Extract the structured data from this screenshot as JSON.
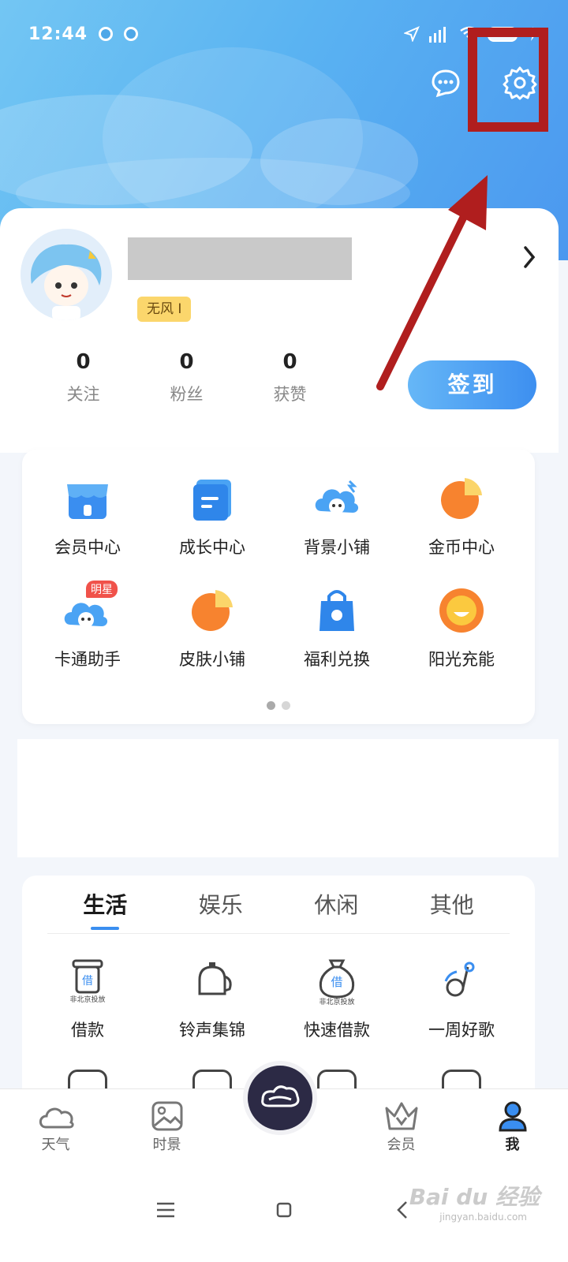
{
  "status_bar": {
    "time": "12:44",
    "battery": "40"
  },
  "profile": {
    "badge": "无风 I",
    "stats": [
      {
        "value": "0",
        "label": "关注"
      },
      {
        "value": "0",
        "label": "粉丝"
      },
      {
        "value": "0",
        "label": "获赞"
      }
    ],
    "signin_label": "签到"
  },
  "feature_grid": {
    "items": [
      {
        "label": "会员中心",
        "icon": "store-icon"
      },
      {
        "label": "成长中心",
        "icon": "document-icon"
      },
      {
        "label": "背景小铺",
        "icon": "cloud-character-icon"
      },
      {
        "label": "金币中心",
        "icon": "coin-pie-icon"
      },
      {
        "label": "卡通助手",
        "icon": "cartoon-helper-icon",
        "tag": "明星"
      },
      {
        "label": "皮肤小铺",
        "icon": "skin-pie-icon"
      },
      {
        "label": "福利兑换",
        "icon": "gift-bag-icon"
      },
      {
        "label": "阳光充能",
        "icon": "sun-icon"
      }
    ],
    "page_count": 2,
    "current_page": 1
  },
  "categories": {
    "tabs": [
      "生活",
      "娱乐",
      "休闲",
      "其他"
    ],
    "active_tab": "生活",
    "items": [
      {
        "label": "借款",
        "icon": "loan-icon",
        "icon_text": "借",
        "sub": "非北京投放"
      },
      {
        "label": "铃声集锦",
        "icon": "bell-icon"
      },
      {
        "label": "快速借款",
        "icon": "money-bag-icon",
        "icon_text": "借",
        "sub": "非北京投放"
      },
      {
        "label": "一周好歌",
        "icon": "music-note-icon"
      }
    ]
  },
  "bottom_nav": {
    "items": [
      {
        "label": "天气",
        "icon": "cloud-icon"
      },
      {
        "label": "时景",
        "icon": "picture-icon"
      },
      {
        "label": "",
        "icon": "center-logo-icon"
      },
      {
        "label": "会员",
        "icon": "crown-icon"
      },
      {
        "label": "我",
        "icon": "person-icon"
      }
    ],
    "active": "我"
  },
  "watermark": {
    "text": "Bai du 经验",
    "sub": "jingyan.baidu.com"
  },
  "colors": {
    "accent": "#3d8ff0",
    "highlight": "#b01e1e",
    "badge": "#fbd66c"
  }
}
